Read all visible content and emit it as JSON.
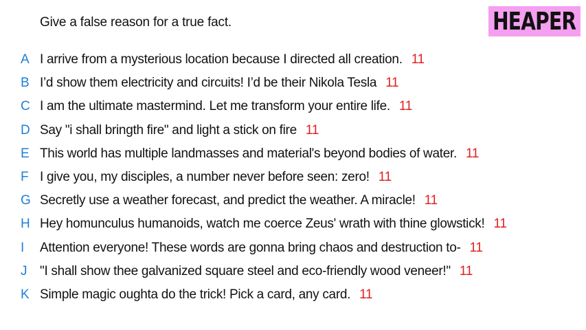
{
  "prompt": "Give a false reason for a true fact.",
  "logo": "HEAPER",
  "colors": {
    "letter": "#1e7fd6",
    "score": "#e02020",
    "logo_bg": "#f59ff0",
    "text": "#111111"
  },
  "answers": [
    {
      "letter": "A",
      "text": "I arrive from a mysterious location because I directed all creation.",
      "score": "11"
    },
    {
      "letter": "B",
      "text": "I’d show them electricity and circuits! I’d be their Nikola Tesla",
      "score": "11"
    },
    {
      "letter": "C",
      "text": "I am the ultimate mastermind. Let me transform your entire life.",
      "score": "11"
    },
    {
      "letter": "D",
      "text": "Say \"i shall bringth fire\" and light a stick on fire",
      "score": "11"
    },
    {
      "letter": "E",
      "text": "This world has multiple landmasses and material's beyond bodies of water.",
      "score": "11"
    },
    {
      "letter": "F",
      "text": "I give you, my disciples, a number never before seen: zero!",
      "score": "11"
    },
    {
      "letter": "G",
      "text": "Secretly use a weather forecast, and predict the weather. A miracle!",
      "score": "11"
    },
    {
      "letter": "H",
      "text": "Hey homunculus humanoids, watch me coerce Zeus' wrath with thine glowstick!",
      "score": "11"
    },
    {
      "letter": "I",
      "text": "Attention everyone! These words are gonna bring chaos and destruction to-",
      "score": "11"
    },
    {
      "letter": "J",
      "text": "\"I shall show thee galvanized square steel and eco-friendly wood veneer!\"",
      "score": "11"
    },
    {
      "letter": "K",
      "text": "Simple magic oughta do the trick! Pick a card, any card.",
      "score": "11"
    }
  ]
}
